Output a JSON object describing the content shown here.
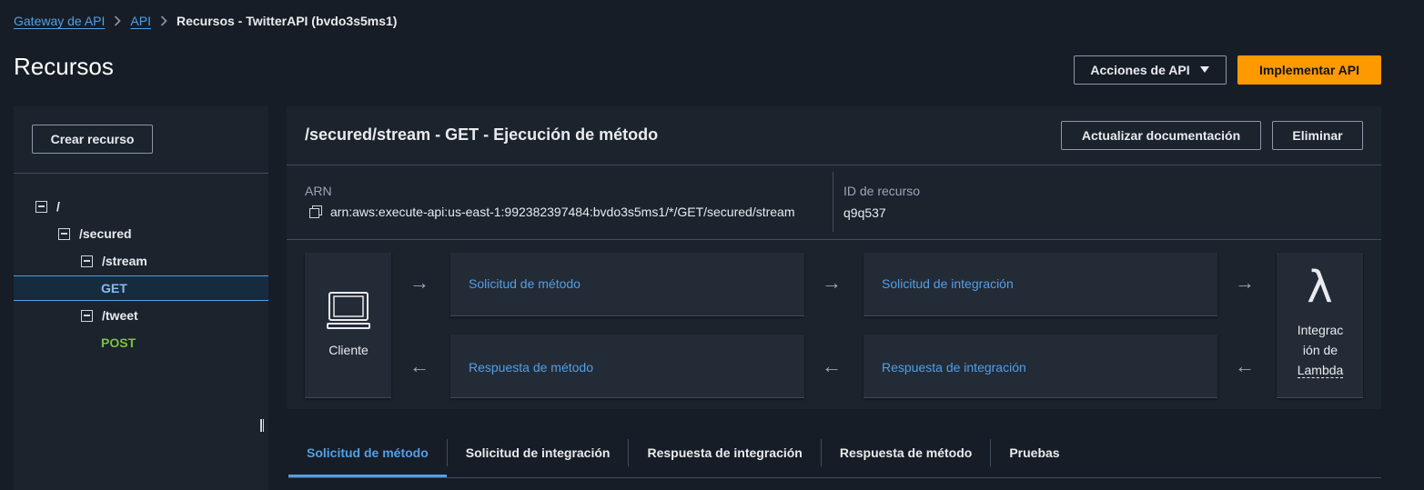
{
  "breadcrumb": {
    "items": [
      "Gateway de API",
      "API"
    ],
    "current": "Recursos - TwitterAPI (bvdo3s5ms1)"
  },
  "page_title": "Recursos",
  "header_actions": {
    "api_actions_label": "Acciones de API",
    "deploy_label": "Implementar API"
  },
  "sidebar": {
    "create_resource_label": "Crear recurso",
    "tree": [
      {
        "label": "/",
        "type": "resource"
      },
      {
        "label": "/secured",
        "type": "resource"
      },
      {
        "label": "/stream",
        "type": "resource"
      },
      {
        "label": "GET",
        "type": "method",
        "selected": true
      },
      {
        "label": "/tweet",
        "type": "resource"
      },
      {
        "label": "POST",
        "type": "method"
      }
    ]
  },
  "panel": {
    "title": "/secured/stream - GET - Ejecución de método",
    "update_docs_label": "Actualizar documentación",
    "delete_label": "Eliminar",
    "arn_label": "ARN",
    "arn_value": "arn:aws:execute-api:us-east-1:992382397484:bvdo3s5ms1/*/GET/secured/stream",
    "resource_id_label": "ID de recurso",
    "resource_id_value": "q9q537"
  },
  "flow": {
    "client_label": "Cliente",
    "method_request": "Solicitud de método",
    "integration_request": "Solicitud de integración",
    "method_response": "Respuesta de método",
    "integration_response": "Respuesta de integración",
    "lambda_line1": "Integrac",
    "lambda_line2": "ión de",
    "lambda_line3": "Lambda",
    "lambda_symbol": "λ",
    "arrow_right": "→",
    "arrow_left": "←"
  },
  "tabs": [
    {
      "label": "Solicitud de método",
      "active": true
    },
    {
      "label": "Solicitud de integración"
    },
    {
      "label": "Respuesta de integración"
    },
    {
      "label": "Respuesta de método"
    },
    {
      "label": "Pruebas"
    }
  ],
  "colors": {
    "background": "#161d26",
    "panel": "#1b232d",
    "link": "#539fe5",
    "primary": "#ff9900",
    "post_method": "#7bc043"
  }
}
